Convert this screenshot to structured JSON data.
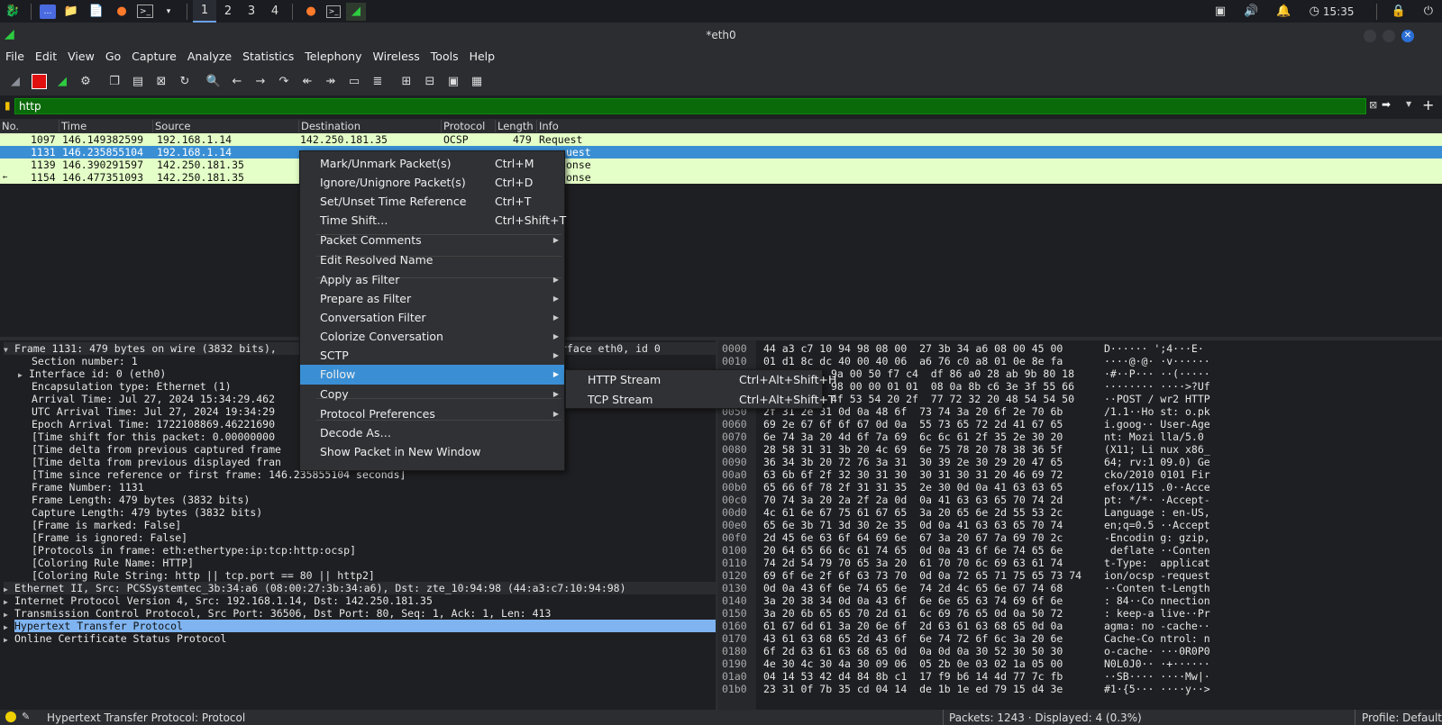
{
  "taskbar": {
    "workspaces": [
      "1",
      "2",
      "3",
      "4"
    ],
    "clock": "15:35"
  },
  "window": {
    "title": "*eth0"
  },
  "menubar": [
    "File",
    "Edit",
    "View",
    "Go",
    "Capture",
    "Analyze",
    "Statistics",
    "Telephony",
    "Wireless",
    "Tools",
    "Help"
  ],
  "filter": {
    "value": "http"
  },
  "packet_list": {
    "columns": [
      "No.",
      "Time",
      "Source",
      "Destination",
      "Protocol",
      "Length",
      "Info"
    ],
    "rows": [
      {
        "no": "1097",
        "time": "146.149382599",
        "src": "192.168.1.14",
        "dst": "142.250.181.35",
        "proto": "OCSP",
        "len": "479",
        "info": "Request"
      },
      {
        "no": "1131",
        "time": "146.235855104",
        "src": "192.168.1.14",
        "dst": "",
        "proto": "",
        "len": "",
        "info": "uest"
      },
      {
        "no": "1139",
        "time": "146.390291597",
        "src": "142.250.181.35",
        "dst": "",
        "proto": "",
        "len": "",
        "info": "onse"
      },
      {
        "no": "1154",
        "time": "146.477351093",
        "src": "142.250.181.35",
        "dst": "",
        "proto": "",
        "len": "",
        "info": "onse"
      }
    ]
  },
  "detail": [
    "Frame 1131: 479 bytes on wire (3832 bits),",
    "Section number: 1",
    "Interface id: 0 (eth0)",
    "Encapsulation type: Ethernet (1)",
    "Arrival Time: Jul 27, 2024 15:34:29.462",
    "UTC Arrival Time: Jul 27, 2024 19:34:29",
    "Epoch Arrival Time: 1722108869.46221690",
    "[Time shift for this packet: 0.00000000",
    "[Time delta from previous captured frame",
    "[Time delta from previous displayed fran",
    "[Time since reference or first frame: 146.235855104 seconds]",
    "Frame Number: 1131",
    "Frame Length: 479 bytes (3832 bits)",
    "Capture Length: 479 bytes (3832 bits)",
    "[Frame is marked: False]",
    "[Frame is ignored: False]",
    "[Protocols in frame: eth:ethertype:ip:tcp:http:ocsp]",
    "[Coloring Rule Name: HTTP]",
    "[Coloring Rule String: http || tcp.port == 80 || http2]",
    "Ethernet II, Src: PCSSystemtec_3b:34:a6 (08:00:27:3b:34:a6), Dst: zte_10:94:98 (44:a3:c7:10:94:98)",
    "Internet Protocol Version 4, Src: 192.168.1.14, Dst: 142.250.181.35",
    "Transmission Control Protocol, Src Port: 36506, Dst Port: 80, Seq: 1, Ack: 1, Len: 413",
    "Hypertext Transfer Protocol",
    "Online Certificate Status Protocol"
  ],
  "detail_frame_tail": "rface eth0, id 0",
  "bytes": [
    {
      "off": "0000",
      "hex": "44 a3 c7 10 94 98 08 00  27 3b 34 a6 08 00 45 00",
      "ascii": "D······ ';4···E·"
    },
    {
      "off": "0010",
      "hex": "01 d1 8c dc 40 00 40 06  a6 76 c0 a8 01 0e 8e fa",
      "ascii": "····@·@· ·v······"
    },
    {
      "off": "",
      "hex": "9a 00 50 f7 c4  df 86 a0 28 ab 9b 80 18",
      "ascii": "·#··P··· ··(·····"
    },
    {
      "off": "",
      "hex": "98 00 00 01 01  08 0a 8b c6 3e 3f 55 66",
      "ascii": "········ ····>?Uf"
    },
    {
      "off": "",
      "hex": "4f 53 54 20 2f  77 72 32 20 48 54 54 50",
      "ascii": "··POST / wr2 HTTP"
    },
    {
      "off": "0050",
      "hex": "2f 31 2e 31 0d 0a 48 6f  73 74 3a 20 6f 2e 70 6b",
      "ascii": "/1.1··Ho st: o.pk"
    },
    {
      "off": "0060",
      "hex": "69 2e 67 6f 6f 67 0d 0a  55 73 65 72 2d 41 67 65",
      "ascii": "i.goog·· User-Age"
    },
    {
      "off": "0070",
      "hex": "6e 74 3a 20 4d 6f 7a 69  6c 6c 61 2f 35 2e 30 20",
      "ascii": "nt: Mozi lla/5.0 "
    },
    {
      "off": "0080",
      "hex": "28 58 31 31 3b 20 4c 69  6e 75 78 20 78 38 36 5f",
      "ascii": "(X11; Li nux x86_"
    },
    {
      "off": "0090",
      "hex": "36 34 3b 20 72 76 3a 31  30 39 2e 30 29 20 47 65",
      "ascii": "64; rv:1 09.0) Ge"
    },
    {
      "off": "00a0",
      "hex": "63 6b 6f 2f 32 30 31 30  30 31 30 31 20 46 69 72",
      "ascii": "cko/2010 0101 Fir"
    },
    {
      "off": "00b0",
      "hex": "65 66 6f 78 2f 31 31 35  2e 30 0d 0a 41 63 63 65",
      "ascii": "efox/115 .0··Acce"
    },
    {
      "off": "00c0",
      "hex": "70 74 3a 20 2a 2f 2a 0d  0a 41 63 63 65 70 74 2d",
      "ascii": "pt: */*· ·Accept-"
    },
    {
      "off": "00d0",
      "hex": "4c 61 6e 67 75 61 67 65  3a 20 65 6e 2d 55 53 2c",
      "ascii": "Language : en-US,"
    },
    {
      "off": "00e0",
      "hex": "65 6e 3b 71 3d 30 2e 35  0d 0a 41 63 63 65 70 74",
      "ascii": "en;q=0.5 ··Accept"
    },
    {
      "off": "00f0",
      "hex": "2d 45 6e 63 6f 64 69 6e  67 3a 20 67 7a 69 70 2c",
      "ascii": "-Encodin g: gzip,"
    },
    {
      "off": "0100",
      "hex": "20 64 65 66 6c 61 74 65  0d 0a 43 6f 6e 74 65 6e",
      "ascii": " deflate ··Conten"
    },
    {
      "off": "0110",
      "hex": "74 2d 54 79 70 65 3a 20  61 70 70 6c 69 63 61 74",
      "ascii": "t-Type:  applicat"
    },
    {
      "off": "0120",
      "hex": "69 6f 6e 2f 6f 63 73 70  0d 0a 72 65 71 75 65 73 74",
      "ascii": "ion/ocsp -request"
    },
    {
      "off": "0130",
      "hex": "0d 0a 43 6f 6e 74 65 6e  74 2d 4c 65 6e 67 74 68",
      "ascii": "··Conten t-Length"
    },
    {
      "off": "0140",
      "hex": "3a 20 38 34 0d 0a 43 6f  6e 6e 65 63 74 69 6f 6e",
      "ascii": ": 84··Co nnection"
    },
    {
      "off": "0150",
      "hex": "3a 20 6b 65 65 70 2d 61  6c 69 76 65 0d 0a 50 72",
      "ascii": ": keep-a live··Pr"
    },
    {
      "off": "0160",
      "hex": "61 67 6d 61 3a 20 6e 6f  2d 63 61 63 68 65 0d 0a",
      "ascii": "agma: no -cache··"
    },
    {
      "off": "0170",
      "hex": "43 61 63 68 65 2d 43 6f  6e 74 72 6f 6c 3a 20 6e",
      "ascii": "Cache-Co ntrol: n"
    },
    {
      "off": "0180",
      "hex": "6f 2d 63 61 63 68 65 0d  0a 0d 0a 30 52 30 50 30",
      "ascii": "o-cache· ···0R0P0"
    },
    {
      "off": "0190",
      "hex": "4e 30 4c 30 4a 30 09 06  05 2b 0e 03 02 1a 05 00",
      "ascii": "N0L0J0·· ·+······"
    },
    {
      "off": "01a0",
      "hex": "04 14 53 42 d4 84 8b c1  17 f9 b6 14 4d 77 7c fb",
      "ascii": "··SB···· ····Mw|·"
    },
    {
      "off": "01b0",
      "hex": "23 31 0f 7b 35 cd 04 14  de 1b 1e ed 79 15 d4 3e",
      "ascii": "#1·{5··· ····y··>"
    }
  ],
  "context_menu": {
    "items": [
      {
        "label": "Mark/Unmark Packet(s)",
        "shortcut": "Ctrl+M",
        "sub": false
      },
      {
        "label": "Ignore/Unignore Packet(s)",
        "shortcut": "Ctrl+D",
        "sub": false
      },
      {
        "label": "Set/Unset Time Reference",
        "shortcut": "Ctrl+T",
        "sub": false
      },
      {
        "label": "Time Shift…",
        "shortcut": "Ctrl+Shift+T",
        "sub": false
      },
      {
        "label": "Packet Comments",
        "shortcut": "",
        "sub": true
      },
      {
        "label": "Edit Resolved Name",
        "shortcut": "",
        "sub": false
      },
      {
        "label": "Apply as Filter",
        "shortcut": "",
        "sub": true
      },
      {
        "label": "Prepare as Filter",
        "shortcut": "",
        "sub": true
      },
      {
        "label": "Conversation Filter",
        "shortcut": "",
        "sub": true
      },
      {
        "label": "Colorize Conversation",
        "shortcut": "",
        "sub": true
      },
      {
        "label": "SCTP",
        "shortcut": "",
        "sub": true
      },
      {
        "label": "Follow",
        "shortcut": "",
        "sub": true
      },
      {
        "label": "Copy",
        "shortcut": "",
        "sub": true
      },
      {
        "label": "Protocol Preferences",
        "shortcut": "",
        "sub": true
      },
      {
        "label": "Decode As…",
        "shortcut": "",
        "sub": false
      },
      {
        "label": "Show Packet in New Window",
        "shortcut": "",
        "sub": false
      }
    ],
    "submenu": [
      {
        "label": "HTTP Stream",
        "shortcut": "Ctrl+Alt+Shift+H"
      },
      {
        "label": "TCP Stream",
        "shortcut": "Ctrl+Alt+Shift+T"
      }
    ]
  },
  "status": {
    "field": "Hypertext Transfer Protocol: Protocol",
    "packets": "Packets: 1243 · Displayed: 4 (0.3%)",
    "profile": "Profile: Default"
  },
  "colors": {
    "row_http": "#e4ffc7",
    "row_selected": "#3a8fd4",
    "filter_valid": "#0a6a0a",
    "highlight": "#7fb4f0"
  }
}
